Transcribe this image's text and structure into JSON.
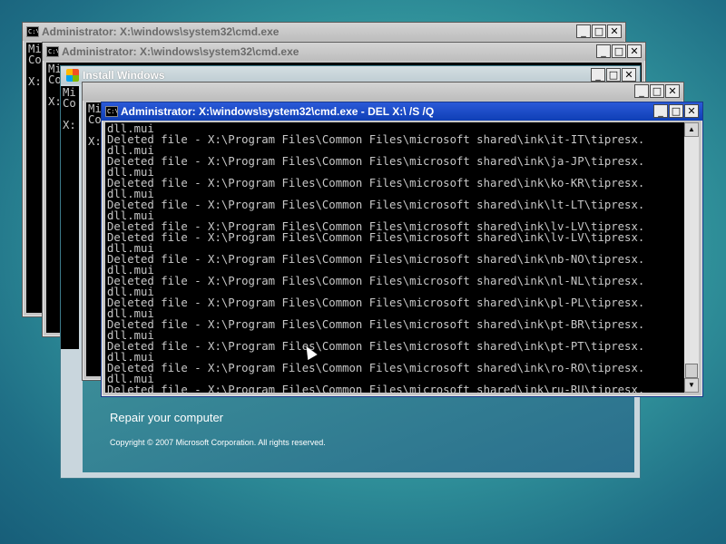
{
  "windows": {
    "back1": {
      "title": "Administrator: X:\\windows\\system32\\cmd.exe",
      "console": "Mi\nCo\n\nX:"
    },
    "back2": {
      "title": "Administrator: X:\\windows\\system32\\cmd.exe",
      "console": "Mi\nCo\n\nX:"
    },
    "install": {
      "title": "Install Windows",
      "console_a": "Mi\nCo\n\nX:",
      "console_b": "Mi\nCo\n\nX:"
    },
    "front": {
      "title": "Administrator: X:\\windows\\system32\\cmd.exe - DEL  X:\\ /S /Q",
      "console": "dll.mui\nDeleted file - X:\\Program Files\\Common Files\\microsoft shared\\ink\\it-IT\\tipresx.\ndll.mui\nDeleted file - X:\\Program Files\\Common Files\\microsoft shared\\ink\\ja-JP\\tipresx.\ndll.mui\nDeleted file - X:\\Program Files\\Common Files\\microsoft shared\\ink\\ko-KR\\tipresx.\ndll.mui\nDeleted file - X:\\Program Files\\Common Files\\microsoft shared\\ink\\lt-LT\\tipresx.\ndll.mui\nDeleted file - X:\\Program Files\\Common Files\\microsoft shared\\ink\\lv-LV\\tipresx.\nDeleted file - X:\\Program Files\\Common Files\\microsoft shared\\ink\\lv-LV\\tipresx.\ndll.mui\nDeleted file - X:\\Program Files\\Common Files\\microsoft shared\\ink\\nb-NO\\tipresx.\ndll.mui\nDeleted file - X:\\Program Files\\Common Files\\microsoft shared\\ink\\nl-NL\\tipresx.\ndll.mui\nDeleted file - X:\\Program Files\\Common Files\\microsoft shared\\ink\\pl-PL\\tipresx.\ndll.mui\nDeleted file - X:\\Program Files\\Common Files\\microsoft shared\\ink\\pt-BR\\tipresx.\ndll.mui\nDeleted file - X:\\Program Files\\Common Files\\microsoft shared\\ink\\pt-PT\\tipresx.\ndll.mui\nDeleted file - X:\\Program Files\\Common Files\\microsoft shared\\ink\\ro-RO\\tipresx.\ndll.mui\nDeleted file - X:\\Program Files\\Common Files\\microsoft shared\\ink\\ru-RU\\tipresx."
    }
  },
  "install_screen": {
    "repair_link": "Repair your computer",
    "copyright": "Copyright © 2007 Microsoft Corporation. All rights reserved."
  },
  "controls": {
    "minimize": "_",
    "maximize": "□",
    "close": "✕",
    "scroll_up": "▲",
    "scroll_down": "▼"
  },
  "icons": {
    "cmd": "C:\\",
    "window_controls": [
      "minimize-icon",
      "maximize-icon",
      "close-icon"
    ]
  },
  "colors": {
    "console_bg": "#000000",
    "console_text": "#c8c8c8",
    "active_title": "#1f4fc8"
  }
}
